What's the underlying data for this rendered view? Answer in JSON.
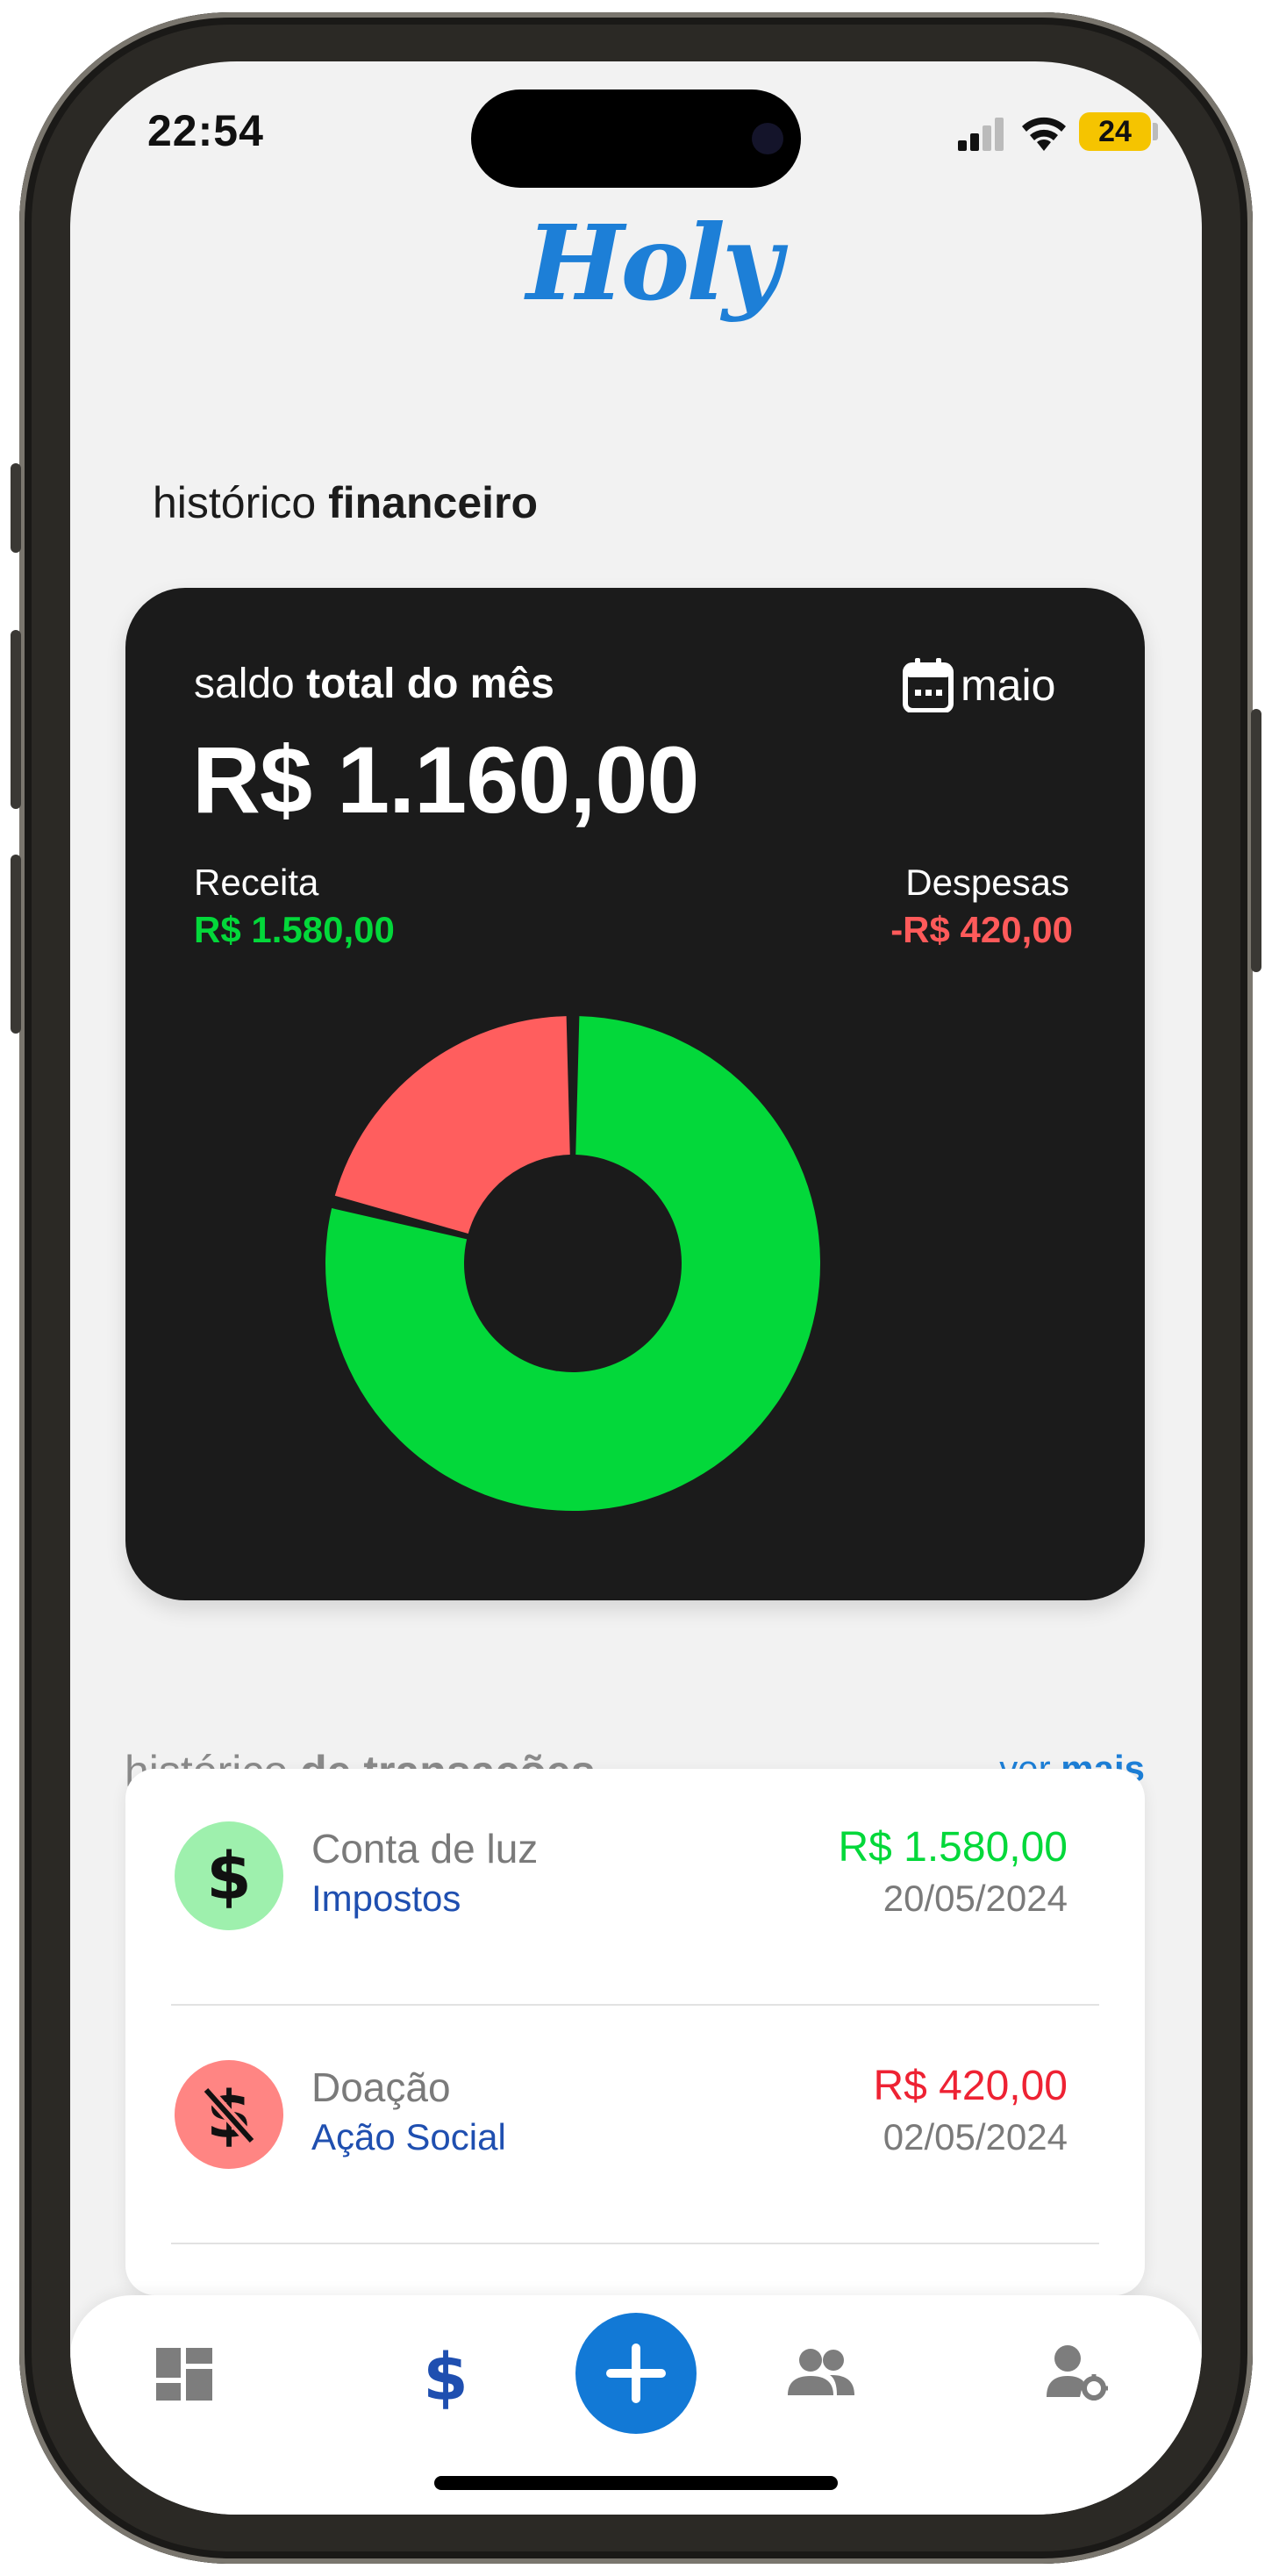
{
  "status_bar": {
    "time": "22:54",
    "battery": "24"
  },
  "app": {
    "brand": "Holy"
  },
  "financial_history": {
    "title_light": "histórico",
    "title_bold": "financeiro"
  },
  "balance_card": {
    "label_light": "saldo",
    "label_bold": "total do mês",
    "month": "maio",
    "total": "R$ 1.160,00",
    "income_label": "Receita",
    "income_value": "R$ 1.580,00",
    "expense_label": "Despesas",
    "expense_value": "-R$ 420,00"
  },
  "chart_data": {
    "type": "pie",
    "variant": "donut",
    "series": [
      {
        "value": 1580,
        "color": "#03d83a"
      },
      {
        "value": 420,
        "color": "#ff5e5e"
      }
    ]
  },
  "transactions": {
    "title_light": "histórico",
    "title_bold": "de transações",
    "more_light": "ver",
    "more_bold": "mais",
    "items": [
      {
        "name": "Conta de luz",
        "category": "Impostos",
        "amount": "R$ 1.580,00",
        "date": "20/05/2024",
        "type": "income",
        "icon": "dollar-icon"
      },
      {
        "name": "Doação",
        "category": "Ação Social",
        "amount": "R$ 420,00",
        "date": "02/05/2024",
        "type": "expense",
        "icon": "dollar-off-icon"
      }
    ]
  },
  "tab_bar": {
    "items": [
      {
        "icon": "dashboard-icon"
      },
      {
        "icon": "dollar-icon",
        "active": true
      },
      {
        "icon": "plus-icon"
      },
      {
        "icon": "users-icon"
      },
      {
        "icon": "user-settings-icon"
      }
    ]
  },
  "colors": {
    "accent": "#1d7fd7",
    "income": "#03d83a",
    "expense": "#ff5a5a",
    "card": "#1b1b1b",
    "category_link": "#1f4fb0"
  }
}
